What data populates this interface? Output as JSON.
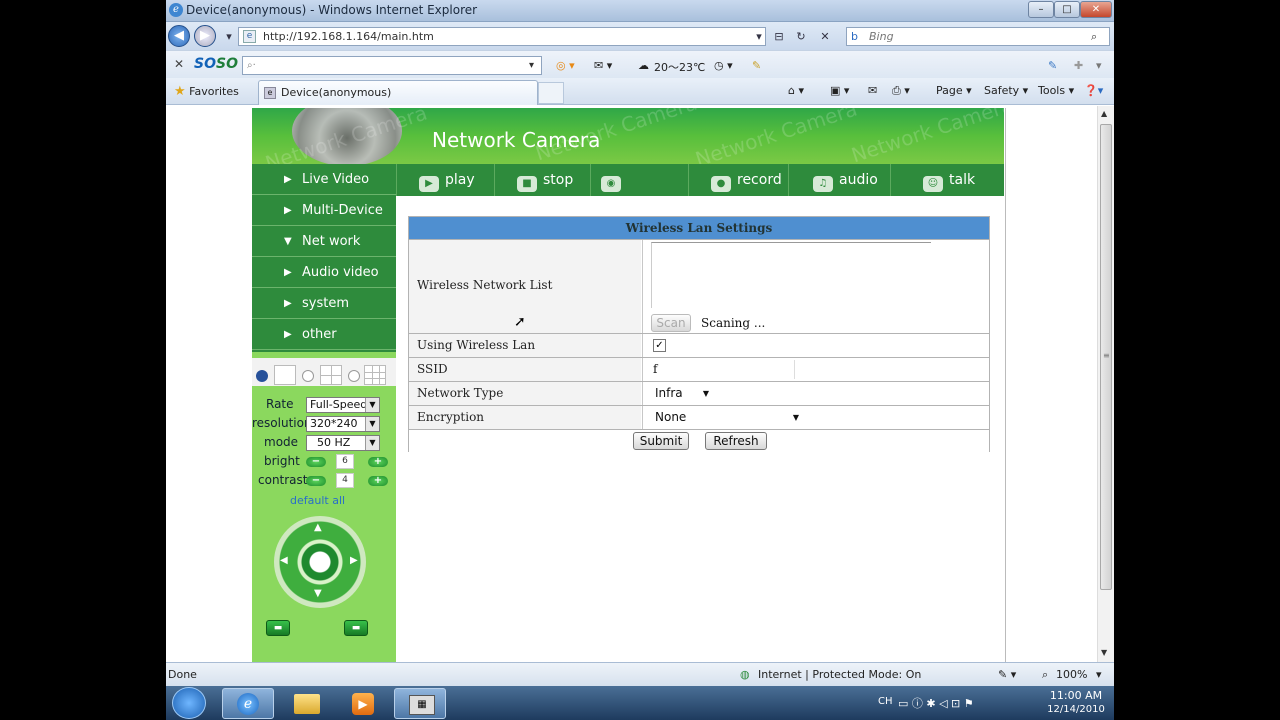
{
  "window": {
    "title": "Device(anonymous) - Windows Internet Explorer",
    "controls": [
      "–",
      "□",
      "✕"
    ]
  },
  "addressbar": {
    "url": "http://192.168.1.164/main.htm",
    "search_placeholder": "Bing"
  },
  "soso": {
    "logo_a": "SO",
    "logo_b": "SO",
    "search_placeholder": "",
    "weather": "20～23℃"
  },
  "favorites": {
    "label": "Favorites",
    "tab_title": "Device(anonymous)",
    "commands": [
      "Page ▾",
      "Safety ▾",
      "Tools ▾"
    ]
  },
  "camera_page": {
    "banner_title": "Network Camera",
    "watermark": "Network Camera",
    "toolbar": [
      "play",
      "stop",
      "snapshot",
      "record",
      "audio",
      "talk"
    ],
    "menu": [
      {
        "arrow": "▶",
        "label": "Live Video"
      },
      {
        "arrow": "▶",
        "label": "Multi-Device"
      },
      {
        "arrow": "▼",
        "label": "Net work"
      },
      {
        "arrow": "▶",
        "label": "Audio video"
      },
      {
        "arrow": "▶",
        "label": "system"
      },
      {
        "arrow": "▶",
        "label": "other"
      }
    ],
    "controls": {
      "rate_label": "Rate",
      "rate_value": "Full-Speed",
      "resolution_label": "resolution",
      "resolution_value": "320*240",
      "mode_label": "mode",
      "mode_value": "50 HZ",
      "bright_label": "bright",
      "bright_value": "6",
      "contrast_label": "contrast",
      "contrast_value": "4",
      "default_all": "default all"
    }
  },
  "wireless_form": {
    "header": "Wireless Lan Settings",
    "network_list_label": "Wireless Network List",
    "scan_button": "Scan",
    "scan_status": "Scaning ...",
    "using_wireless_label": "Using Wireless Lan",
    "using_wireless_checked": true,
    "ssid_label": "SSID",
    "ssid_value": "f",
    "network_type_label": "Network Type",
    "network_type_value": "Infra",
    "encryption_label": "Encryption",
    "encryption_value": "None",
    "submit": "Submit",
    "refresh": "Refresh"
  },
  "statusbar": {
    "left": "Done",
    "zone": "Internet | Protected Mode: On",
    "zoom": "100%"
  },
  "taskbar": {
    "time": "11:00 AM",
    "date": "12/14/2010",
    "lang": "CH"
  }
}
